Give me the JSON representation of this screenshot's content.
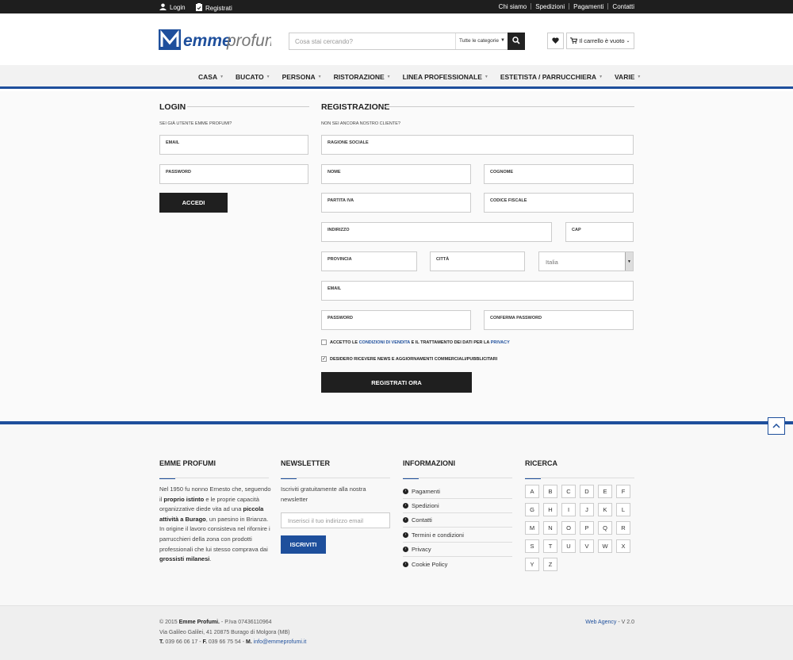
{
  "topbar": {
    "login": "Login",
    "register": "Registrati",
    "links": [
      "Chi siamo",
      "Spedizioni",
      "Pagamenti",
      "Contatti"
    ]
  },
  "header": {
    "logo_text": "emmeprofumi",
    "search_placeholder": "Cosa stai cercando?",
    "category_select": "Tutte le categorie",
    "cart_label": "Il carrello è vuoto"
  },
  "nav": {
    "items": [
      "CASA",
      "BUCATO",
      "PERSONA",
      "RISTORAZIONE",
      "LINEA PROFESSIONALE",
      "ESTETISTA / PARRUCCHIERA",
      "VARIE"
    ]
  },
  "login": {
    "title": "LOGIN",
    "subtitle": "SEI GIÀ UTENTE EMME PROFUMI?",
    "email": "EMAIL",
    "password": "PASSWORD",
    "button": "ACCEDI"
  },
  "registration": {
    "title": "REGISTRAZIONE",
    "subtitle": "NON SEI ANCORA NOSTRO CLIENTE?",
    "fields": {
      "ragione_sociale": "RAGIONE SOCIALE",
      "nome": "NOME",
      "cognome": "COGNOME",
      "partita_iva": "PARTITA IVA",
      "codice_fiscale": "CODICE FISCALE",
      "indirizzo": "INDIRIZZO",
      "cap": "CAP",
      "provincia": "PROVINCIA",
      "citta": "CITTÀ",
      "country": "Italia",
      "email": "EMAIL",
      "password": "PASSWORD",
      "conferma_password": "CONFERMA PASSWORD"
    },
    "terms_prefix": "ACCETTO LE ",
    "terms_link": "CONDIZIONI DI VENDITA",
    "terms_middle": " E IL TRATTAMENTO DEI DATI PER LA ",
    "terms_privacy": "PRIVACY",
    "newsletter_check": "DESIDERO RICEVERE NEWS E AGGIORNAMENTI COMMERCIALI/PUBBLICITARI",
    "button": "REGISTRATI ORA"
  },
  "footer": {
    "about_title": "EMME PROFUMI",
    "newsletter_title": "NEWSLETTER",
    "newsletter_text_1": "Iscriviti gratuitamente alla nostra",
    "newsletter_text_2": "newsletter",
    "newsletter_placeholder": "Inserisci il tuo indirizzo email",
    "newsletter_button": "ISCRIVITI",
    "info_title": "INFORMAZIONI",
    "info_links": [
      "Pagamenti",
      "Spedizioni",
      "Contatti",
      "Termini e condizioni",
      "Privacy",
      "Cookie Policy"
    ],
    "search_title": "RICERCA",
    "letters": [
      "A",
      "B",
      "C",
      "D",
      "E",
      "F",
      "G",
      "H",
      "I",
      "J",
      "K",
      "L",
      "M",
      "N",
      "O",
      "P",
      "Q",
      "R",
      "S",
      "T",
      "U",
      "V",
      "W",
      "X",
      "Y",
      "Z"
    ]
  },
  "bottom": {
    "line1_prefix": "© 2015 ",
    "company": "Emme Profumi.",
    "line1_suffix": " - P.Iva 07436110964",
    "line2": "Via Galileo Galilei, 41 20875 Burago di Molgora (MB)",
    "phone_t": "T.",
    "phone": " 039 66 06 17 - ",
    "fax_f": "F.",
    "fax": " 039 66 75 54 - ",
    "mail_m": "M.",
    "mail": " info@emmeprofumi.it",
    "agency": "Web Agency",
    "version": " - V 2.0"
  },
  "colors": {
    "accent": "#1e4f9c",
    "dark": "#1f1f1f"
  }
}
